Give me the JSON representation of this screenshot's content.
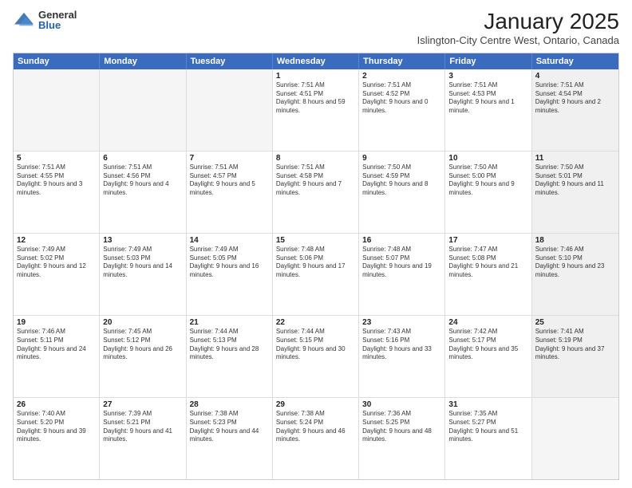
{
  "logo": {
    "general": "General",
    "blue": "Blue"
  },
  "header": {
    "month": "January 2025",
    "location": "Islington-City Centre West, Ontario, Canada"
  },
  "dayHeaders": [
    "Sunday",
    "Monday",
    "Tuesday",
    "Wednesday",
    "Thursday",
    "Friday",
    "Saturday"
  ],
  "weeks": [
    [
      {
        "num": "",
        "empty": true
      },
      {
        "num": "",
        "empty": true
      },
      {
        "num": "",
        "empty": true
      },
      {
        "num": "1",
        "sunrise": "7:51 AM",
        "sunset": "4:51 PM",
        "daylight": "8 hours and 59 minutes."
      },
      {
        "num": "2",
        "sunrise": "7:51 AM",
        "sunset": "4:52 PM",
        "daylight": "9 hours and 0 minutes."
      },
      {
        "num": "3",
        "sunrise": "7:51 AM",
        "sunset": "4:53 PM",
        "daylight": "9 hours and 1 minute."
      },
      {
        "num": "4",
        "sunrise": "7:51 AM",
        "sunset": "4:54 PM",
        "daylight": "9 hours and 2 minutes.",
        "shaded": true
      }
    ],
    [
      {
        "num": "5",
        "sunrise": "7:51 AM",
        "sunset": "4:55 PM",
        "daylight": "9 hours and 3 minutes."
      },
      {
        "num": "6",
        "sunrise": "7:51 AM",
        "sunset": "4:56 PM",
        "daylight": "9 hours and 4 minutes."
      },
      {
        "num": "7",
        "sunrise": "7:51 AM",
        "sunset": "4:57 PM",
        "daylight": "9 hours and 5 minutes."
      },
      {
        "num": "8",
        "sunrise": "7:51 AM",
        "sunset": "4:58 PM",
        "daylight": "9 hours and 7 minutes."
      },
      {
        "num": "9",
        "sunrise": "7:50 AM",
        "sunset": "4:59 PM",
        "daylight": "9 hours and 8 minutes."
      },
      {
        "num": "10",
        "sunrise": "7:50 AM",
        "sunset": "5:00 PM",
        "daylight": "9 hours and 9 minutes."
      },
      {
        "num": "11",
        "sunrise": "7:50 AM",
        "sunset": "5:01 PM",
        "daylight": "9 hours and 11 minutes.",
        "shaded": true
      }
    ],
    [
      {
        "num": "12",
        "sunrise": "7:49 AM",
        "sunset": "5:02 PM",
        "daylight": "9 hours and 12 minutes."
      },
      {
        "num": "13",
        "sunrise": "7:49 AM",
        "sunset": "5:03 PM",
        "daylight": "9 hours and 14 minutes."
      },
      {
        "num": "14",
        "sunrise": "7:49 AM",
        "sunset": "5:05 PM",
        "daylight": "9 hours and 16 minutes."
      },
      {
        "num": "15",
        "sunrise": "7:48 AM",
        "sunset": "5:06 PM",
        "daylight": "9 hours and 17 minutes."
      },
      {
        "num": "16",
        "sunrise": "7:48 AM",
        "sunset": "5:07 PM",
        "daylight": "9 hours and 19 minutes."
      },
      {
        "num": "17",
        "sunrise": "7:47 AM",
        "sunset": "5:08 PM",
        "daylight": "9 hours and 21 minutes."
      },
      {
        "num": "18",
        "sunrise": "7:46 AM",
        "sunset": "5:10 PM",
        "daylight": "9 hours and 23 minutes.",
        "shaded": true
      }
    ],
    [
      {
        "num": "19",
        "sunrise": "7:46 AM",
        "sunset": "5:11 PM",
        "daylight": "9 hours and 24 minutes."
      },
      {
        "num": "20",
        "sunrise": "7:45 AM",
        "sunset": "5:12 PM",
        "daylight": "9 hours and 26 minutes."
      },
      {
        "num": "21",
        "sunrise": "7:44 AM",
        "sunset": "5:13 PM",
        "daylight": "9 hours and 28 minutes."
      },
      {
        "num": "22",
        "sunrise": "7:44 AM",
        "sunset": "5:15 PM",
        "daylight": "9 hours and 30 minutes."
      },
      {
        "num": "23",
        "sunrise": "7:43 AM",
        "sunset": "5:16 PM",
        "daylight": "9 hours and 33 minutes."
      },
      {
        "num": "24",
        "sunrise": "7:42 AM",
        "sunset": "5:17 PM",
        "daylight": "9 hours and 35 minutes."
      },
      {
        "num": "25",
        "sunrise": "7:41 AM",
        "sunset": "5:19 PM",
        "daylight": "9 hours and 37 minutes.",
        "shaded": true
      }
    ],
    [
      {
        "num": "26",
        "sunrise": "7:40 AM",
        "sunset": "5:20 PM",
        "daylight": "9 hours and 39 minutes."
      },
      {
        "num": "27",
        "sunrise": "7:39 AM",
        "sunset": "5:21 PM",
        "daylight": "9 hours and 41 minutes."
      },
      {
        "num": "28",
        "sunrise": "7:38 AM",
        "sunset": "5:23 PM",
        "daylight": "9 hours and 44 minutes."
      },
      {
        "num": "29",
        "sunrise": "7:38 AM",
        "sunset": "5:24 PM",
        "daylight": "9 hours and 46 minutes."
      },
      {
        "num": "30",
        "sunrise": "7:36 AM",
        "sunset": "5:25 PM",
        "daylight": "9 hours and 48 minutes."
      },
      {
        "num": "31",
        "sunrise": "7:35 AM",
        "sunset": "5:27 PM",
        "daylight": "9 hours and 51 minutes."
      },
      {
        "num": "",
        "empty": true,
        "shaded": true
      }
    ]
  ],
  "labels": {
    "sunrise": "Sunrise:",
    "sunset": "Sunset:",
    "daylight": "Daylight:"
  }
}
